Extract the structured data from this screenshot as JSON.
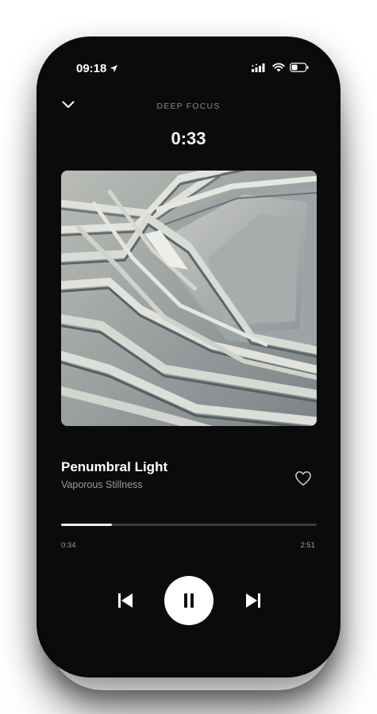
{
  "status_bar": {
    "time": "09:18",
    "icons": [
      "location-arrow-icon",
      "signal-icon",
      "wifi-icon",
      "battery-icon"
    ]
  },
  "header": {
    "collapse_icon": "chevron-down-icon",
    "playlist_title": "DEEP FOCUS",
    "timer": "0:33"
  },
  "track": {
    "title": "Penumbral Light",
    "artist": "Vaporous Stillness",
    "like_icon": "heart-outline-icon"
  },
  "playback": {
    "elapsed": "0:34",
    "total": "2:51",
    "progress": 0.2
  },
  "controls": {
    "prev_icon": "skip-previous-icon",
    "play_icon": "pause-icon",
    "next_icon": "skip-next-icon"
  },
  "colors": {
    "background": "#0b0b0b",
    "accent": "#ffffff",
    "muted_text": "#9a9a9a"
  }
}
